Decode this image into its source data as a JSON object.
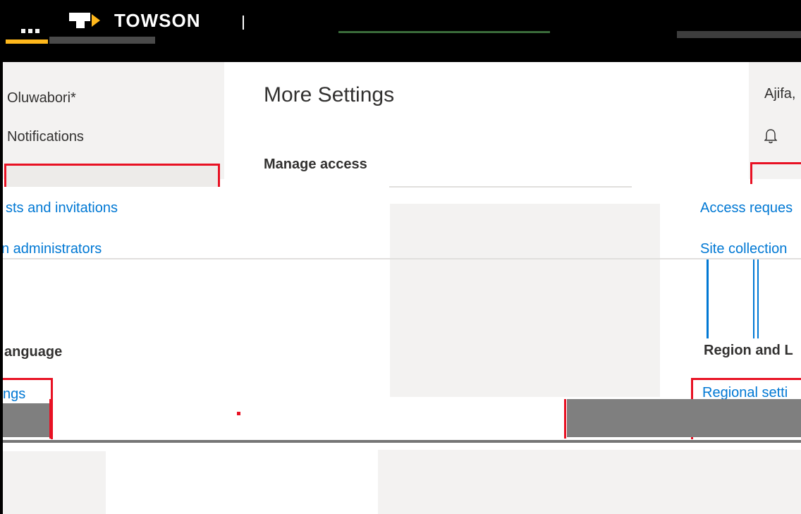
{
  "brand": {
    "name": "TOWSON"
  },
  "left_nav": {
    "user_name": "Oluwabori*",
    "notifications": "Notifications"
  },
  "main": {
    "title": "More Settings",
    "manage_access": "Manage access",
    "access_link": "sts and invitations",
    "admins_link": "n administrators",
    "region_heading": "anguage",
    "settings_link": "ngs"
  },
  "right_pane": {
    "user_name": "Ajifa,",
    "access_link": "Access reques",
    "site_link": "Site collection",
    "region_heading": "Region and L",
    "regional_link": "Regional setti"
  },
  "colors": {
    "accent": "#0078d4",
    "highlight": "#e81123",
    "brand": "#ffb81c",
    "bar": "#000000"
  }
}
